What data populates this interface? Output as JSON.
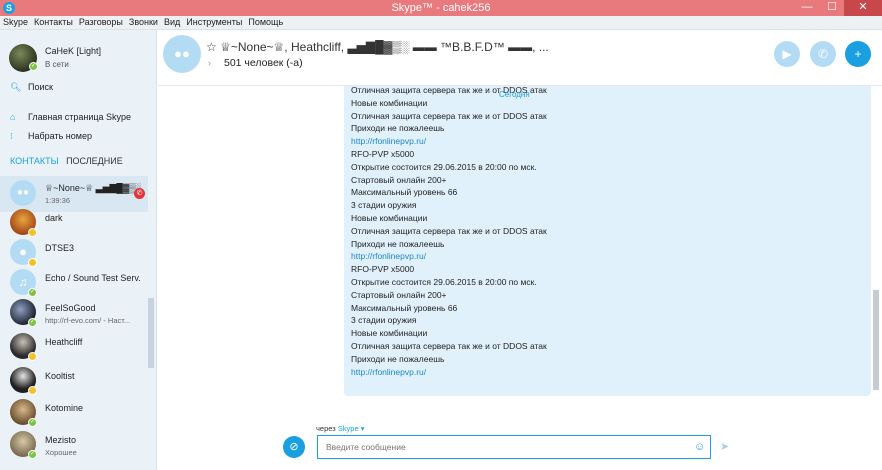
{
  "window": {
    "title": "Skype™ - cahek256",
    "min": "—",
    "max": "☐",
    "close": "✕",
    "logo": "S"
  },
  "menu": [
    "Skype",
    "Контакты",
    "Разговоры",
    "Звонки",
    "Вид",
    "Инструменты",
    "Помощь"
  ],
  "profile": {
    "name": "CaHeK [Light]",
    "status": "В сети"
  },
  "nav": {
    "search": "Поиск",
    "home": "Главная страница Skype",
    "dial": "Набрать номер"
  },
  "tabs": {
    "contacts": "КОНТАКТЫ",
    "recent": "ПОСЛЕДНИЕ"
  },
  "contacts": [
    {
      "name": "♕~None~♕ ▃▅▇█▓▒░",
      "sub": "1:39:36",
      "status": "call",
      "avatar": "group"
    },
    {
      "name": "dark",
      "sub": "",
      "status": "away",
      "avatar": "orange"
    },
    {
      "name": "DTSE3",
      "sub": "",
      "status": "away",
      "avatar": "default"
    },
    {
      "name": "Echo / Sound Test Serv...",
      "sub": "",
      "status": "online",
      "avatar": "echo"
    },
    {
      "name": "FeelSoGood",
      "sub": "http://rf-evo.com/ - Наст...",
      "status": "online",
      "avatar": "dark"
    },
    {
      "name": "Heathcliff",
      "sub": "",
      "status": "away",
      "avatar": "dark2"
    },
    {
      "name": "Kooltist",
      "sub": "",
      "status": "away",
      "avatar": "dark3"
    },
    {
      "name": "Kotomine",
      "sub": "",
      "status": "online",
      "avatar": "tan"
    },
    {
      "name": "Mezisto",
      "sub": "Хорошее",
      "status": "online",
      "avatar": "tan2"
    }
  ],
  "conversation": {
    "title": "☆ ♕~None~♕, Heathcliff, ▃▅▇█▓▒░ ▬▬ ™B.B.F.D™ ▬▬, ...",
    "participants": "501 человек (-а)",
    "today_label": "Сегодня"
  },
  "messages": [
    {
      "text": "Отличная защита сервера так же и от DDOS атак",
      "link": false
    },
    {
      "text": "Новые комбинации",
      "link": false
    },
    {
      "text": "Отличная защита сервера так же и от DDOS атак",
      "link": false
    },
    {
      "text": "Приходи не пожалеешь",
      "link": false
    },
    {
      "text": "http://rfonlinepvp.ru/",
      "link": true
    },
    {
      "text": "RFO-PVP x5000",
      "link": false
    },
    {
      "text": "Открытие состоится 29.06.2015 в 20:00 по мск.",
      "link": false
    },
    {
      "text": "Стартовый онлайн 200+",
      "link": false
    },
    {
      "text": "Максимальный уровень 66",
      "link": false
    },
    {
      "text": "3 стадии оружия",
      "link": false
    },
    {
      "text": "Новые комбинации",
      "link": false
    },
    {
      "text": "Отличная защита сервера так же и от DDOS атак",
      "link": false
    },
    {
      "text": "Приходи не пожалеешь",
      "link": false
    },
    {
      "text": "http://rfonlinepvp.ru/",
      "link": true
    },
    {
      "text": "RFO-PVP x5000",
      "link": false
    },
    {
      "text": "Открытие состоится 29.06.2015 в 20:00 по мск.",
      "link": false
    },
    {
      "text": "Стартовый онлайн 200+",
      "link": false
    },
    {
      "text": "Максимальный уровень 66",
      "link": false
    },
    {
      "text": "3 стадии оружия",
      "link": false
    },
    {
      "text": "Новые комбинации",
      "link": false
    },
    {
      "text": "Отличная защита сервера так же и от DDOS атак",
      "link": false
    },
    {
      "text": "Приходи не пожалеешь",
      "link": false
    },
    {
      "text": "http://rfonlinepvp.ru/",
      "link": true
    }
  ],
  "composer": {
    "via_prefix": "через",
    "via_service": "Skype ▾",
    "placeholder": "Введите сообщение"
  },
  "icons": {
    "search": "search-icon",
    "home": "home-icon",
    "dial": "dialpad-icon",
    "video": "video-call-icon",
    "call": "phone-icon",
    "add": "add-person-icon",
    "attach": "paperclip-icon",
    "emoji": "emoji-icon",
    "send": "send-icon"
  },
  "colors": {
    "accent": "#1a9fe0",
    "titlebar": "#e8797d",
    "bubble": "#e1f1fb",
    "online": "#7dc242",
    "away": "#f4c12b",
    "endcall": "#e3333b"
  }
}
